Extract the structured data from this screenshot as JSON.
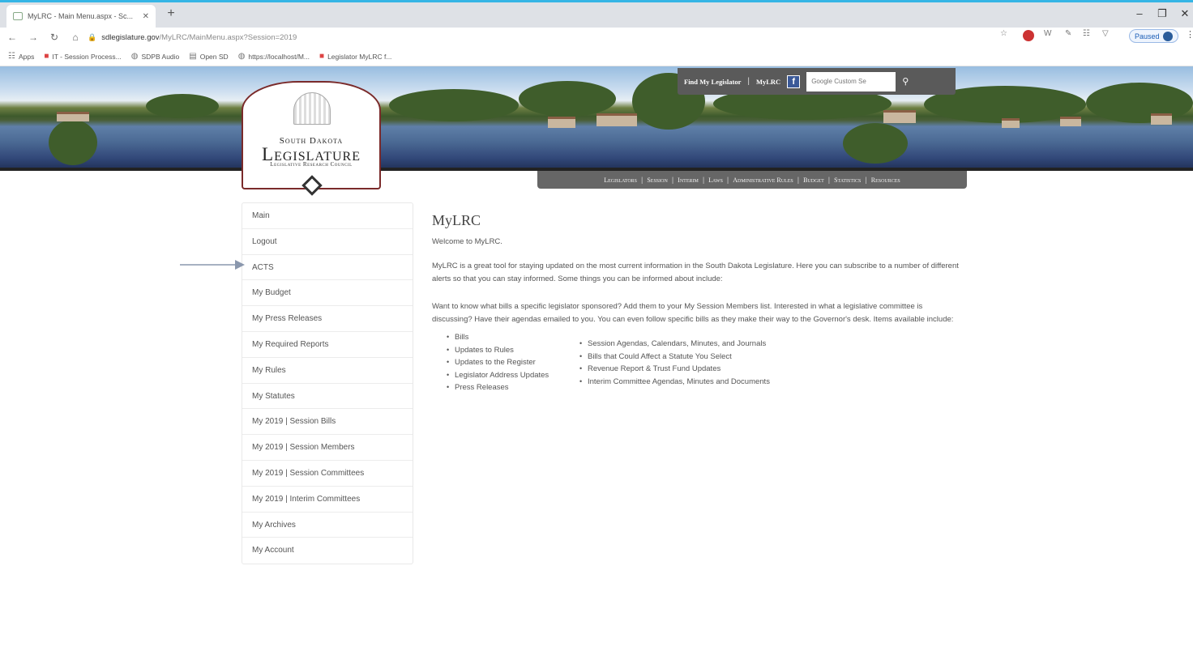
{
  "browser": {
    "tab_title": "MyLRC - Main Menu.aspx - Sc...",
    "url_host": "sdlegislature.gov",
    "url_path": "/MyLRC/MainMenu.aspx?Session=2019",
    "profile_label": "Paused",
    "bookmarks": [
      "Apps",
      "IT - Session Process...",
      "SDPB Audio",
      "Open SD",
      "https://localhost/M...",
      "Legislator MyLRC f..."
    ]
  },
  "site": {
    "logo": {
      "line1": "South Dakota",
      "line2": "Legislature",
      "line3": "Legislative Research Council"
    },
    "topbar": {
      "find_legislator": "Find My Legislator",
      "mylrc": "MyLRC",
      "facebook": "f",
      "search_placeholder": "Google Custom Se"
    },
    "mainnav": [
      "Legislators",
      "Session",
      "Interim",
      "Laws",
      "Administrative Rules",
      "Budget",
      "Statistics",
      "Resources"
    ]
  },
  "sidemenu": [
    "Main",
    "Logout",
    "ACTS",
    "My Budget",
    "My Press Releases",
    "My Required Reports",
    "My Rules",
    "My Statutes",
    "My 2019 | Session Bills",
    "My 2019 | Session Members",
    "My 2019 | Session Committees",
    "My 2019 | Interim Committees",
    "My Archives",
    "My Account"
  ],
  "content": {
    "title": "MyLRC",
    "welcome": "Welcome to MyLRC.",
    "intro": "MyLRC is a great tool for staying updated on the most current information in the South Dakota Legislature. Here you can subscribe to a number of different alerts so that you can stay informed. Some things you can be informed about include:",
    "details": "Want to know what bills a specific legislator sponsored? Add them to your My Session Members list. Interested in what a legislative committee is discussing? Have their agendas emailed to you. You can even follow specific bills as they make their way to the Governor's desk. Items available include:",
    "list_left": [
      "Bills",
      "Updates to Rules",
      "Updates to the Register",
      "Legislator Address Updates",
      "Press Releases"
    ],
    "list_right": [
      "Session Agendas, Calendars, Minutes, and Journals",
      "Bills that Could Affect a Statute You Select",
      "Revenue Report & Trust Fund Updates",
      "Interim Committee Agendas, Minutes and Documents"
    ]
  },
  "colors": {
    "accent_top": "#35b5e5",
    "logo_border": "#7a2a2a",
    "nav_bg": "#666666",
    "facebook": "#3b5998"
  }
}
